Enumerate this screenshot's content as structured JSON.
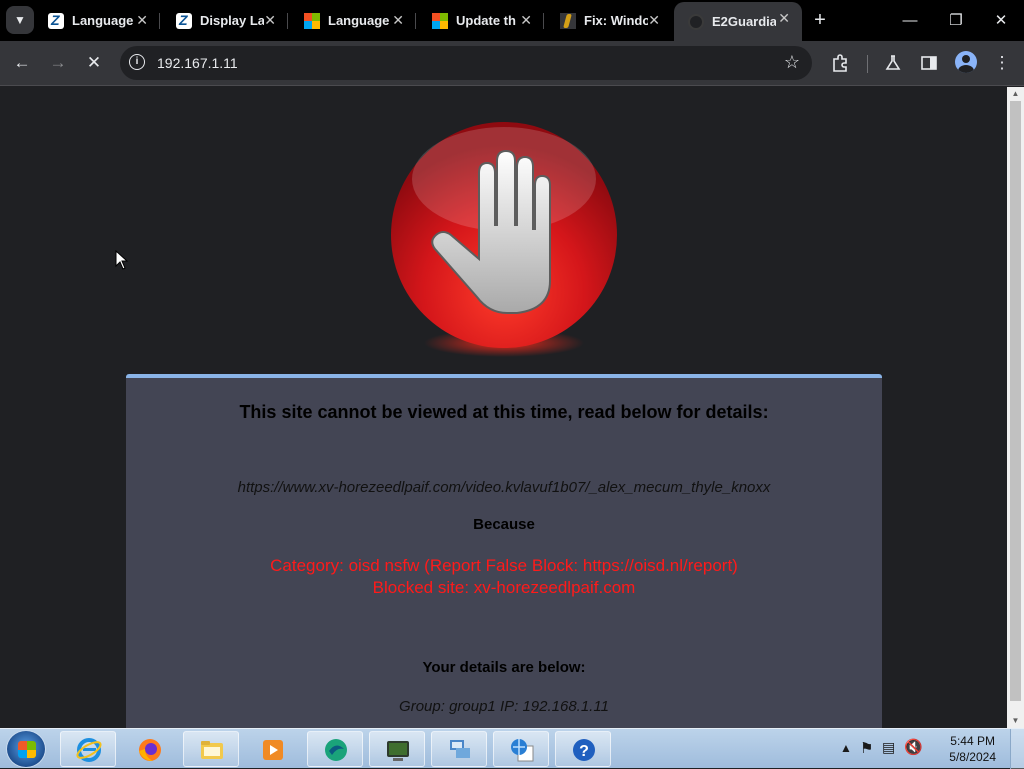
{
  "browser": {
    "tabs": [
      {
        "title": "Language",
        "favicon": "z-icon"
      },
      {
        "title": "Display La",
        "favicon": "z-icon"
      },
      {
        "title": "Language",
        "favicon": "microsoft-icon"
      },
      {
        "title": "Update th",
        "favicon": "microsoft-icon"
      },
      {
        "title": "Fix: Windo",
        "favicon": "fix-icon"
      },
      {
        "title": "E2Guardia",
        "favicon": "globe-icon",
        "active": true
      }
    ],
    "address_bar": {
      "url": "192.167.1.11"
    }
  },
  "page": {
    "heading": "This site cannot be viewed at this time, read below for details:",
    "blocked_url": "https://www.xv-horezeedlpaif.com/video.kvlavuf1b07/_alex_mecum_thyle_knoxx",
    "because_label": "Because",
    "reason_line1": "Category: oisd nsfw (Report False Block: https://oisd.nl/report)",
    "reason_line2": "Blocked site: xv-horezeedlpaif.com",
    "details_title": "Your details are below:",
    "details_line": "Group: group1   IP: 192.168.1.11",
    "colors": {
      "reason": "#ff1a1a",
      "panel": "#434554",
      "accent": "#8ab4e8"
    }
  },
  "taskbar": {
    "apps": [
      "internet-explorer-icon",
      "firefox-icon",
      "file-explorer-icon",
      "media-player-icon",
      "app-icon",
      "terminal-icon",
      "network-icon",
      "globe-document-icon",
      "help-icon"
    ],
    "clock": {
      "time": "5:44 PM",
      "date": "5/8/2024"
    }
  }
}
